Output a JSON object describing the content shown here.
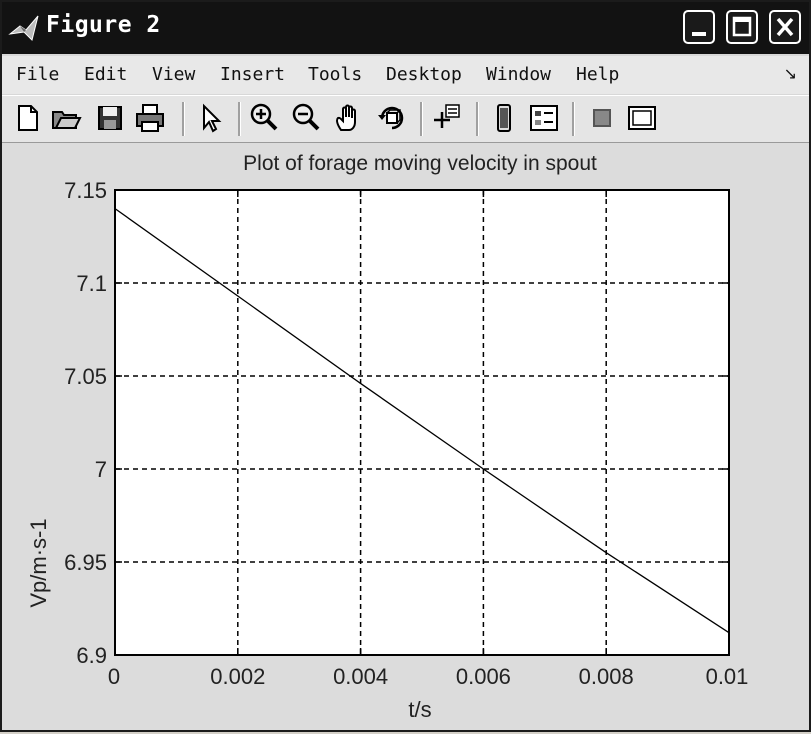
{
  "window": {
    "title": "Figure 2"
  },
  "menu": {
    "items": [
      "File",
      "Edit",
      "View",
      "Insert",
      "Tools",
      "Desktop",
      "Window",
      "Help"
    ]
  },
  "toolbar": {
    "icons": [
      "new-file-icon",
      "open-folder-icon",
      "save-icon",
      "print-icon",
      "pointer-icon",
      "zoom-in-icon",
      "zoom-out-icon",
      "pan-hand-icon",
      "rotate-3d-icon",
      "data-cursor-icon",
      "colorbar-icon",
      "legend-icon",
      "hide-plot-tools-icon",
      "show-plot-tools-icon"
    ]
  },
  "chart_data": {
    "type": "line",
    "title": "Plot of forage moving velocity in spout",
    "xlabel": "t/s",
    "ylabel": "Vp/m·s-1",
    "xlim": [
      0,
      0.01
    ],
    "ylim": [
      6.9,
      7.15
    ],
    "xticks": [
      0,
      0.002,
      0.004,
      0.006,
      0.008,
      0.01
    ],
    "xtick_labels": [
      "0",
      "0.002",
      "0.004",
      "0.006",
      "0.008",
      "0.01"
    ],
    "yticks": [
      6.9,
      6.95,
      7.0,
      7.05,
      7.1,
      7.15
    ],
    "ytick_labels": [
      "6.9",
      "6.95",
      "7",
      "7.05",
      "7.1",
      "7.15"
    ],
    "grid": true,
    "series": [
      {
        "x": [
          0,
          0.002,
          0.004,
          0.006,
          0.008,
          0.01
        ],
        "y": [
          7.14,
          7.093,
          7.046,
          7.0,
          6.955,
          6.912
        ]
      }
    ]
  }
}
